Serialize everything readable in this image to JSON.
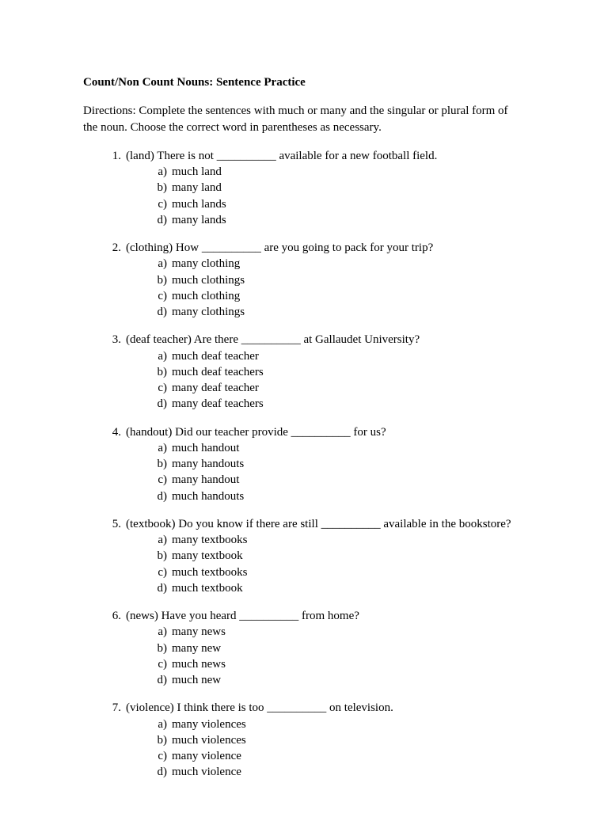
{
  "title": "Count/Non Count Nouns: Sentence Practice",
  "directions": "Directions: Complete the sentences with much or many and the singular or plural form of the noun. Choose the correct word in parentheses as necessary.",
  "questions": [
    {
      "num": "1.",
      "text": "(land) There is not __________ available for a new football field.",
      "options": [
        {
          "letter": "a)",
          "text": "much land"
        },
        {
          "letter": "b)",
          "text": "many land"
        },
        {
          "letter": "c)",
          "text": "much lands"
        },
        {
          "letter": "d)",
          "text": "many lands"
        }
      ]
    },
    {
      "num": "2.",
      "text": "(clothing) How __________ are you going to pack for your trip?",
      "options": [
        {
          "letter": "a)",
          "text": "many clothing"
        },
        {
          "letter": "b)",
          "text": "much clothings"
        },
        {
          "letter": "c)",
          "text": "much clothing"
        },
        {
          "letter": "d)",
          "text": "many clothings"
        }
      ]
    },
    {
      "num": "3.",
      "text": "(deaf teacher) Are there __________ at Gallaudet University?",
      "options": [
        {
          "letter": "a)",
          "text": "much deaf teacher"
        },
        {
          "letter": "b)",
          "text": "much deaf teachers"
        },
        {
          "letter": "c)",
          "text": "many deaf teacher"
        },
        {
          "letter": "d)",
          "text": "many deaf teachers"
        }
      ]
    },
    {
      "num": "4.",
      "text": "(handout) Did our teacher provide __________ for us?",
      "options": [
        {
          "letter": "a)",
          "text": "much handout"
        },
        {
          "letter": "b)",
          "text": "many handouts"
        },
        {
          "letter": "c)",
          "text": "many handout"
        },
        {
          "letter": "d)",
          "text": "much handouts"
        }
      ]
    },
    {
      "num": "5.",
      "text": "(textbook) Do you know if there are still __________ available in the bookstore?",
      "options": [
        {
          "letter": "a)",
          "text": "many textbooks"
        },
        {
          "letter": "b)",
          "text": "many textbook"
        },
        {
          "letter": "c)",
          "text": "much textbooks"
        },
        {
          "letter": "d)",
          "text": "much textbook"
        }
      ]
    },
    {
      "num": "6.",
      "text": "(news) Have you heard __________ from home?",
      "options": [
        {
          "letter": "a)",
          "text": "many news"
        },
        {
          "letter": "b)",
          "text": "many new"
        },
        {
          "letter": "c)",
          "text": "much news"
        },
        {
          "letter": "d)",
          "text": "much new"
        }
      ]
    },
    {
      "num": "7.",
      "text": "(violence) I think there is too __________ on television.",
      "options": [
        {
          "letter": "a)",
          "text": "many violences"
        },
        {
          "letter": "b)",
          "text": "much violences"
        },
        {
          "letter": "c)",
          "text": "many violence"
        },
        {
          "letter": "d)",
          "text": "much violence"
        }
      ]
    }
  ]
}
